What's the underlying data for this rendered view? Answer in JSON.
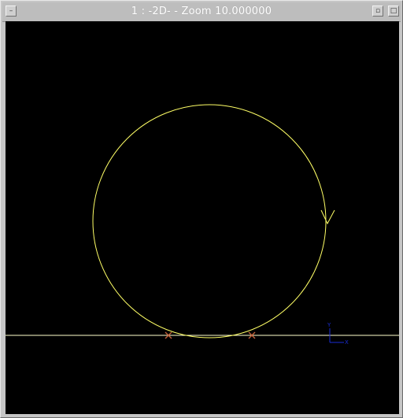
{
  "window": {
    "title": "1 : -2D- - Zoom 10.000000"
  },
  "titlebar": {
    "menu_icon": "window-menu-icon",
    "minimize_icon": "minimize-icon",
    "maximize_icon": "maximize-icon"
  },
  "viewport": {
    "background": "#000000",
    "curve_color": "#ffff66",
    "line_color": "#ffffcc",
    "marker_color": "#c0603a",
    "axis_color": "#1a2dd4",
    "axis_x_label": "X",
    "axis_y_label": "Y"
  }
}
